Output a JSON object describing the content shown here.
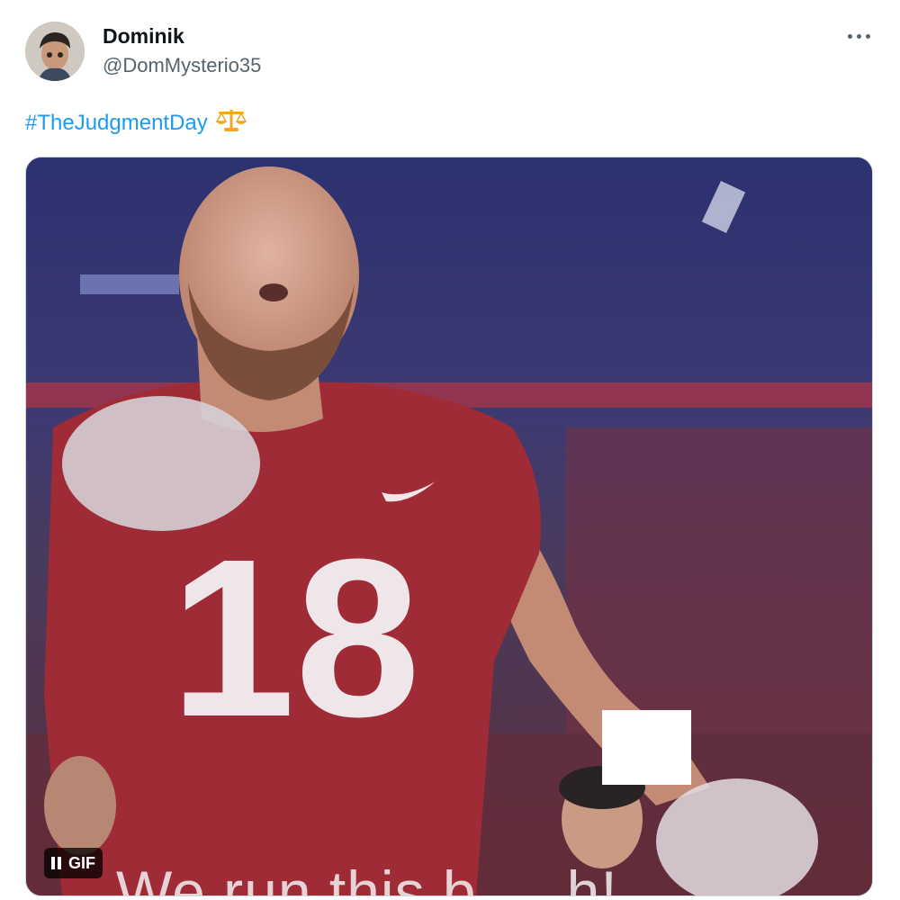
{
  "author": {
    "display_name": "Dominik",
    "handle": "@DomMysterio35"
  },
  "tweet": {
    "hashtag": "#TheJudgmentDay",
    "emoji": "⚖️"
  },
  "media": {
    "caption": "We run this b",
    "caption_end": "h!",
    "badge_label": "GIF",
    "jersey_number": "18"
  },
  "icons": {
    "more": "more-options-icon",
    "pause": "pause-icon"
  },
  "colors": {
    "link": "#1d9bf0",
    "secondary_text": "#536471",
    "jersey": "#9e2b35"
  }
}
